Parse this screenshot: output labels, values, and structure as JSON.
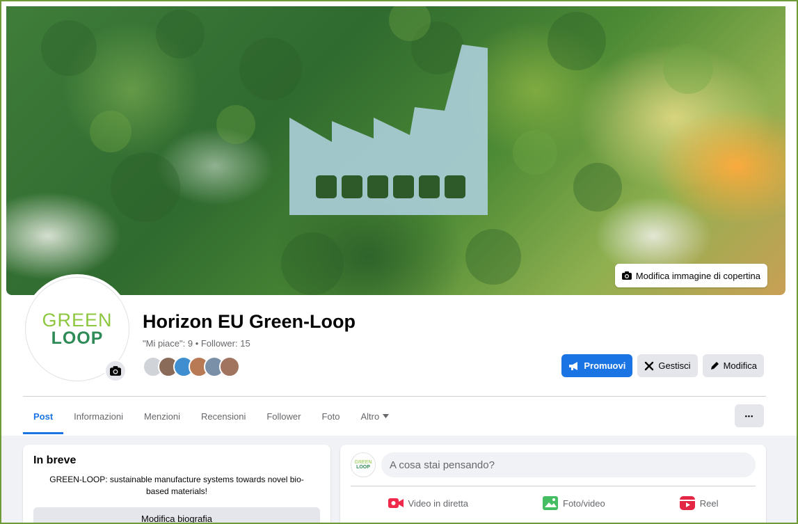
{
  "cover": {
    "edit_label": "Modifica immagine di copertina"
  },
  "profile": {
    "logo_top": "GREEN",
    "logo_bottom": "LOOP",
    "name": "Horizon EU Green-Loop",
    "stats": "\"Mi piace\": 9 • Follower: 15"
  },
  "actions": {
    "promote": "Promuovi",
    "manage": "Gestisci",
    "edit": "Modifica"
  },
  "tabs": [
    {
      "label": "Post"
    },
    {
      "label": "Informazioni"
    },
    {
      "label": "Menzioni"
    },
    {
      "label": "Recensioni"
    },
    {
      "label": "Follower"
    },
    {
      "label": "Foto"
    },
    {
      "label": "Altro"
    }
  ],
  "more_label": "•••",
  "intro": {
    "title": "In breve",
    "text": "GREEN-LOOP: sustainable manufacture systems towards novel bio-based materials!",
    "edit_bio": "Modifica biografia"
  },
  "composer": {
    "placeholder": "A cosa stai pensando?",
    "live": "Video in diretta",
    "photo": "Foto/video",
    "reel": "Reel"
  },
  "colors": {
    "accent": "#1b74e4",
    "logo_light": "#8dc63f",
    "logo_dark": "#2e8b57",
    "live_red": "#f02849",
    "photo_green": "#45bd62"
  }
}
